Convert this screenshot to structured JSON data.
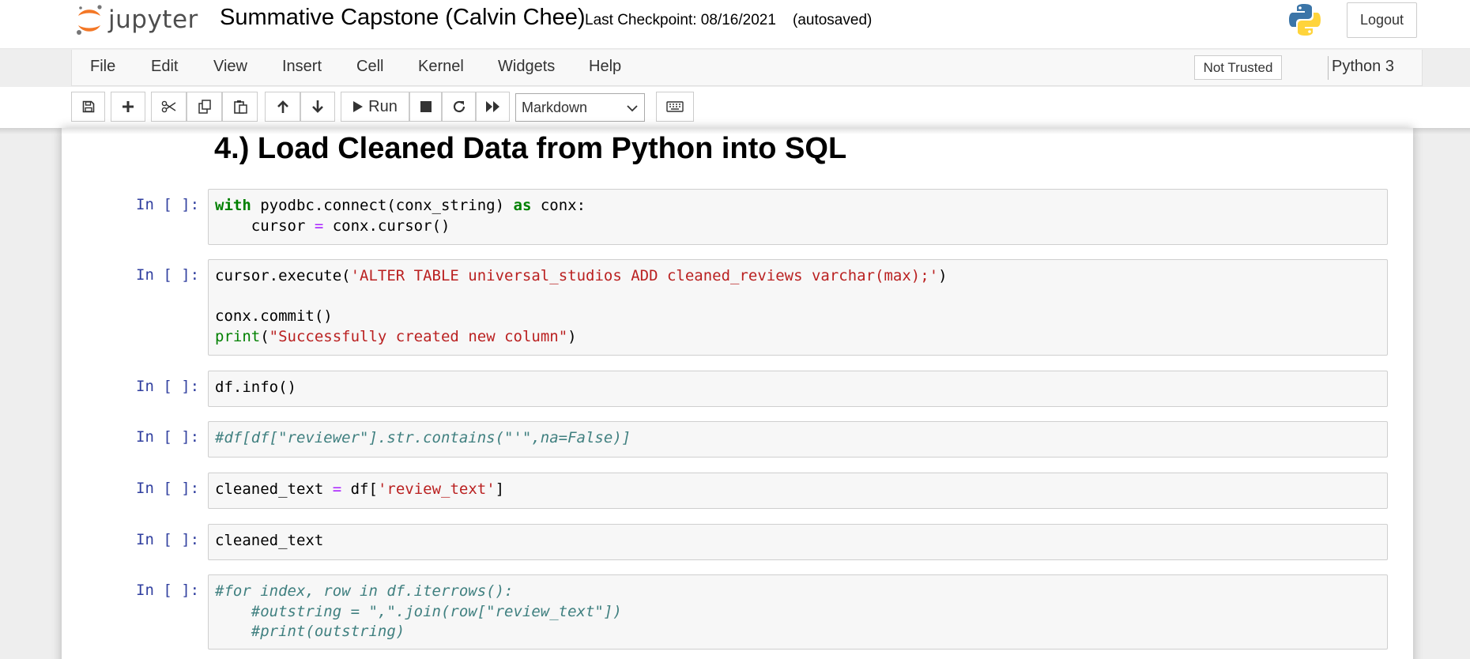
{
  "header": {
    "logo_text": "jupyter",
    "notebook_name": "Summative Capstone (Calvin Chee)",
    "checkpoint": "Last Checkpoint: 08/16/2021",
    "autosave_status": "(autosaved)",
    "logout_label": "Logout"
  },
  "menubar": {
    "items": [
      "File",
      "Edit",
      "View",
      "Insert",
      "Cell",
      "Kernel",
      "Widgets",
      "Help"
    ],
    "trust_status": "Not Trusted",
    "kernel_name": "Python 3"
  },
  "toolbar": {
    "run_label": "Run",
    "cell_type": "Markdown"
  },
  "notebook": {
    "markdown_heading": "4.) Load Cleaned Data from Python into SQL",
    "prompt": "In [ ]:",
    "cells": [
      {
        "lines": [
          [
            {
              "t": "with",
              "c": "kw"
            },
            {
              "t": " pyodbc.connect(conx_string) ",
              "c": ""
            },
            {
              "t": "as",
              "c": "kw"
            },
            {
              "t": " conx:",
              "c": ""
            }
          ],
          [
            {
              "t": "    cursor ",
              "c": ""
            },
            {
              "t": "=",
              "c": "op"
            },
            {
              "t": " conx.cursor()",
              "c": ""
            }
          ]
        ]
      },
      {
        "lines": [
          [
            {
              "t": "cursor.execute(",
              "c": ""
            },
            {
              "t": "'ALTER TABLE universal_studios ADD cleaned_reviews varchar(max);'",
              "c": "str"
            },
            {
              "t": ")",
              "c": ""
            }
          ],
          [],
          [
            {
              "t": "conx.commit()",
              "c": ""
            }
          ],
          [
            {
              "t": "print",
              "c": "bi"
            },
            {
              "t": "(",
              "c": ""
            },
            {
              "t": "\"Successfully created new column\"",
              "c": "str"
            },
            {
              "t": ")",
              "c": ""
            }
          ]
        ]
      },
      {
        "lines": [
          [
            {
              "t": "df.info()",
              "c": ""
            }
          ]
        ]
      },
      {
        "lines": [
          [
            {
              "t": "#df[df[\"reviewer\"].str.contains(\"'\",na=False)]",
              "c": "cm"
            }
          ]
        ]
      },
      {
        "lines": [
          [
            {
              "t": "cleaned_text ",
              "c": ""
            },
            {
              "t": "=",
              "c": "op"
            },
            {
              "t": " df[",
              "c": ""
            },
            {
              "t": "'review_text'",
              "c": "str"
            },
            {
              "t": "]",
              "c": ""
            }
          ]
        ]
      },
      {
        "lines": [
          [
            {
              "t": "cleaned_text",
              "c": ""
            }
          ]
        ]
      },
      {
        "lines": [
          [
            {
              "t": "#for index, row in df.iterrows():",
              "c": "cm"
            }
          ],
          [
            {
              "t": "    #outstring = \",\".join(row[\"review_text\"])",
              "c": "cm"
            }
          ],
          [
            {
              "t": "    #print(outstring)",
              "c": "cm"
            }
          ]
        ]
      }
    ]
  },
  "icons": {
    "save": "floppy-disk-icon",
    "insert": "plus-icon",
    "cut": "scissors-icon",
    "copy": "copy-icon",
    "paste": "paste-icon",
    "move_up": "arrow-up-icon",
    "move_down": "arrow-down-icon",
    "run": "play-icon",
    "interrupt": "stop-icon",
    "restart": "refresh-icon",
    "restart_run_all": "fast-forward-icon",
    "command_palette": "keyboard-icon"
  },
  "colors": {
    "prompt": "#303f9f",
    "keyword": "#008000",
    "string": "#ba2121",
    "operator": "#aa22ff",
    "comment": "#408080",
    "logo_orange": "#f37726"
  }
}
